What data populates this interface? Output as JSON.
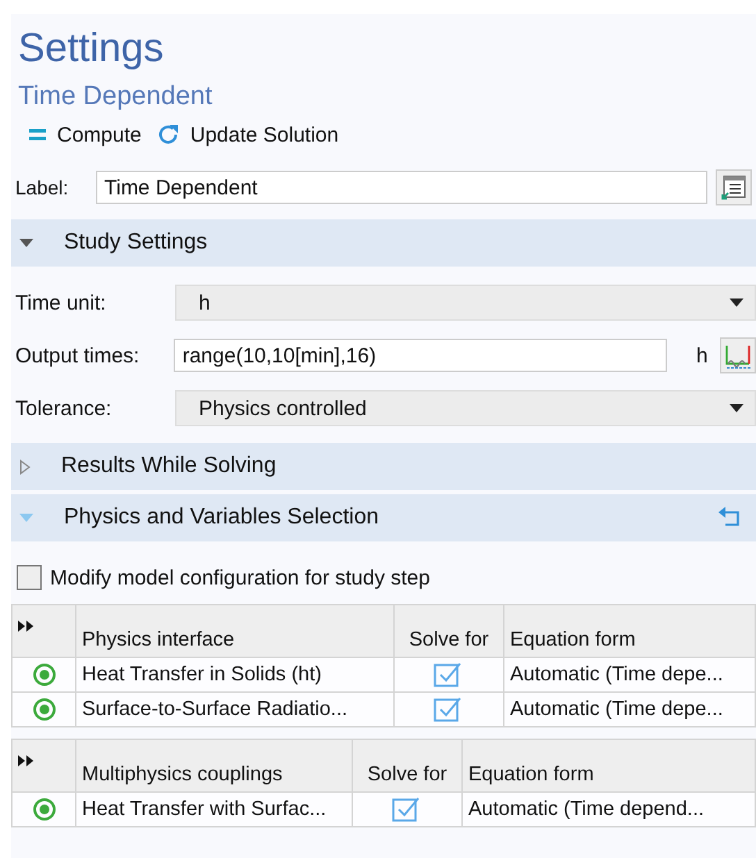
{
  "panel": {
    "title": "Settings",
    "subtitle": "Time Dependent"
  },
  "toolbar": [
    {
      "kind": "compute",
      "label": "Compute"
    },
    {
      "kind": "update",
      "label": "Update Solution"
    }
  ],
  "label_field": {
    "label": "Label:",
    "value": "Time Dependent"
  },
  "sections": [
    {
      "title": "Study Settings",
      "expanded": true,
      "kind": "study",
      "fields": [
        {
          "kind": "select",
          "label": "Time unit:",
          "value": "h"
        },
        {
          "kind": "text",
          "label": "Output times:",
          "value": "range(10,10[min],16)",
          "unit": "h"
        },
        {
          "kind": "select",
          "label": "Tolerance:",
          "value": "Physics controlled"
        }
      ]
    },
    {
      "title": "Results While Solving",
      "expanded": false,
      "kind": "plain"
    },
    {
      "title": "Physics and Variables Selection",
      "expanded": true,
      "kind": "physics",
      "checkbox": {
        "label": "Modify model configuration for study step",
        "checked": false
      },
      "tables": [
        {
          "columns": [
            "Physics interface",
            "Solve for",
            "Equation form"
          ],
          "rows": [
            {
              "name": "Heat Transfer in Solids (ht)",
              "solve_for": true,
              "equation_form": "Automatic (Time depe..."
            },
            {
              "name": "Surface-to-Surface Radiatio...",
              "solve_for": true,
              "equation_form": "Automatic (Time depe..."
            }
          ]
        },
        {
          "columns": [
            "Multiphysics couplings",
            "Solve for",
            "Equation form"
          ],
          "rows": [
            {
              "name": "Heat Transfer with Surfac...",
              "solve_for": true,
              "equation_form": "Automatic (Time depend..."
            }
          ]
        }
      ]
    }
  ]
}
